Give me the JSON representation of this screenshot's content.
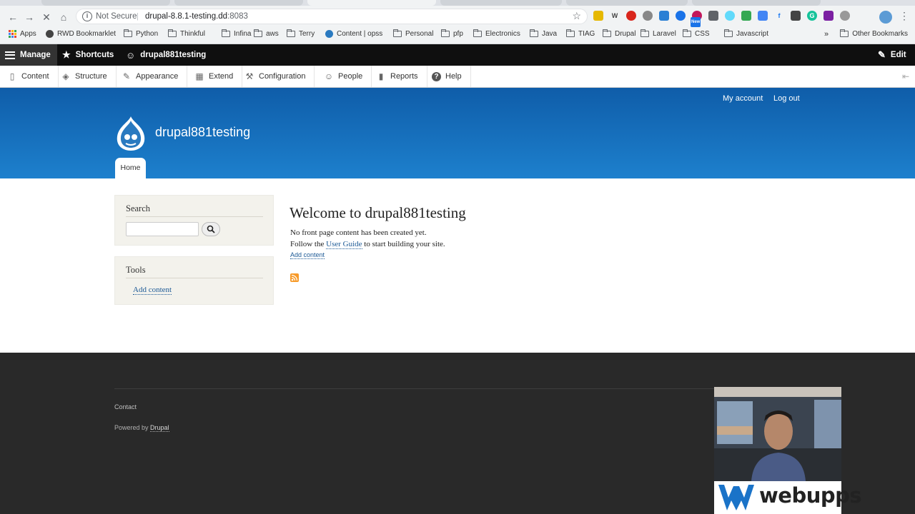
{
  "browser": {
    "url_security": "Not Secure",
    "url_host": "drupal-8.8.1-testing.dd",
    "url_port": ":8083",
    "bookmarks": [
      {
        "label": "Apps",
        "type": "apps"
      },
      {
        "label": "RWD Bookmarklet",
        "type": "bookmark"
      },
      {
        "label": "Python",
        "type": "folder"
      },
      {
        "label": "Thinkful",
        "type": "folder"
      },
      {
        "label": "Infina",
        "type": "folder"
      },
      {
        "label": "aws",
        "type": "folder"
      },
      {
        "label": "Terry",
        "type": "folder"
      },
      {
        "label": "Content | opss",
        "type": "bookmark"
      },
      {
        "label": "Personal",
        "type": "folder"
      },
      {
        "label": "pfp",
        "type": "folder"
      },
      {
        "label": "Electronics",
        "type": "folder"
      },
      {
        "label": "Java",
        "type": "folder"
      },
      {
        "label": "TIAG",
        "type": "folder"
      },
      {
        "label": "Drupal",
        "type": "folder"
      },
      {
        "label": "Laravel",
        "type": "folder"
      },
      {
        "label": "CSS",
        "type": "folder"
      },
      {
        "label": "Javascript",
        "type": "folder"
      }
    ],
    "bookmarks_overflow": "»",
    "other_bookmarks": "Other Bookmarks",
    "ext_new_badge": "New"
  },
  "drupal_toolbar": {
    "manage": "Manage",
    "shortcuts": "Shortcuts",
    "user": "drupal881testing",
    "edit": "Edit"
  },
  "admin_tray": {
    "items": [
      {
        "label": "Content",
        "icon": "file-icon"
      },
      {
        "label": "Structure",
        "icon": "structure-icon"
      },
      {
        "label": "Appearance",
        "icon": "brush-icon"
      },
      {
        "label": "Extend",
        "icon": "puzzle-icon"
      },
      {
        "label": "Configuration",
        "icon": "wrench-icon"
      },
      {
        "label": "People",
        "icon": "people-icon"
      },
      {
        "label": "Reports",
        "icon": "reports-icon"
      },
      {
        "label": "Help",
        "icon": "help-icon"
      }
    ]
  },
  "header": {
    "my_account": "My account",
    "log_out": "Log out",
    "site_name": "drupal881testing",
    "home_tab": "Home"
  },
  "sidebar": {
    "search_title": "Search",
    "tools_title": "Tools",
    "tools_link": "Add content"
  },
  "main": {
    "title": "Welcome to drupal881testing",
    "line1": "No front page content has been created yet.",
    "line2_prefix": "Follow the",
    "line2_link": "User Guide",
    "line2_suffix": "to start building your site.",
    "add_content": "Add content"
  },
  "footer": {
    "contact": "Contact",
    "powered_prefix": "Powered by",
    "powered_link": "Drupal"
  },
  "overlay": {
    "brand": "webupps"
  },
  "colors": {
    "header_top": "#0f5da9",
    "header_bottom": "#1d80cd",
    "link": "#1d5a96",
    "footer_bg": "#292929",
    "toolbar_bg": "#0f0f0f"
  }
}
